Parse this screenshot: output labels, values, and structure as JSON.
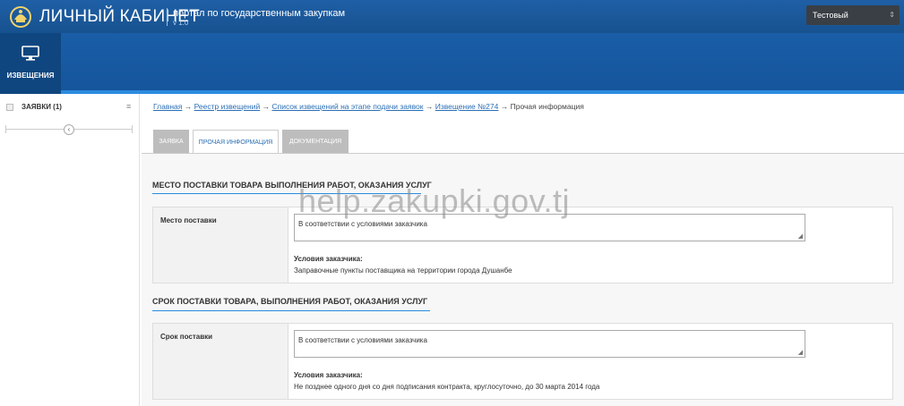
{
  "header": {
    "brand": "ЛИЧНЫЙ КАБИНЕТ",
    "subtitle": "портал по государственным закупкам",
    "version": "v 1.0",
    "user": "Тестовый пользователь"
  },
  "nav": {
    "active_item": "ИЗВЕЩЕНИЯ",
    "active_icon": "monitor-icon"
  },
  "sidebar": {
    "item_label": "ЗАЯВКИ (1)",
    "menu_icon": "≡",
    "collapse_icon": "‹"
  },
  "breadcrumb": {
    "items": [
      "Главная",
      "Реестр извещений",
      "Список извещений на этапе подачи заявок",
      "Извещение №274"
    ],
    "current": "Прочая информация",
    "separator": "→"
  },
  "tabs": [
    "ЗАЯВКА",
    "ПРОЧАЯ ИНФОРМАЦИЯ",
    "ДОКУМЕНТАЦИЯ"
  ],
  "sections": [
    {
      "title": "МЕСТО ПОСТАВКИ ТОВАРА ВЫПОЛНЕНИЯ РАБОТ, ОКАЗАНИЯ УСЛУГ",
      "label": "Место поставки",
      "value": "В соответствии с условиями заказчика",
      "cond_heading": "Условия заказчика:",
      "cond_text": "Заправочные пункты поставщика на территории города Душанбе"
    },
    {
      "title": "СРОК ПОСТАВКИ ТОВАРА, ВЫПОЛНЕНИЯ РАБОТ, ОКАЗАНИЯ УСЛУГ",
      "label": "Срок поставки",
      "value": "В соответствии с условиями заказчика",
      "cond_heading": "Условия заказчика:",
      "cond_text": "Не позднее одного дня со дня подписания контракта, круглосуточно, до 30 марта 2014 года"
    }
  ],
  "watermark": "help.zakupki.gov.tj",
  "colors": {
    "header_blue": "#1f5fa6",
    "nav_active": "#0f467f",
    "accent": "#2a8ae0",
    "link": "#2a6fb5"
  }
}
